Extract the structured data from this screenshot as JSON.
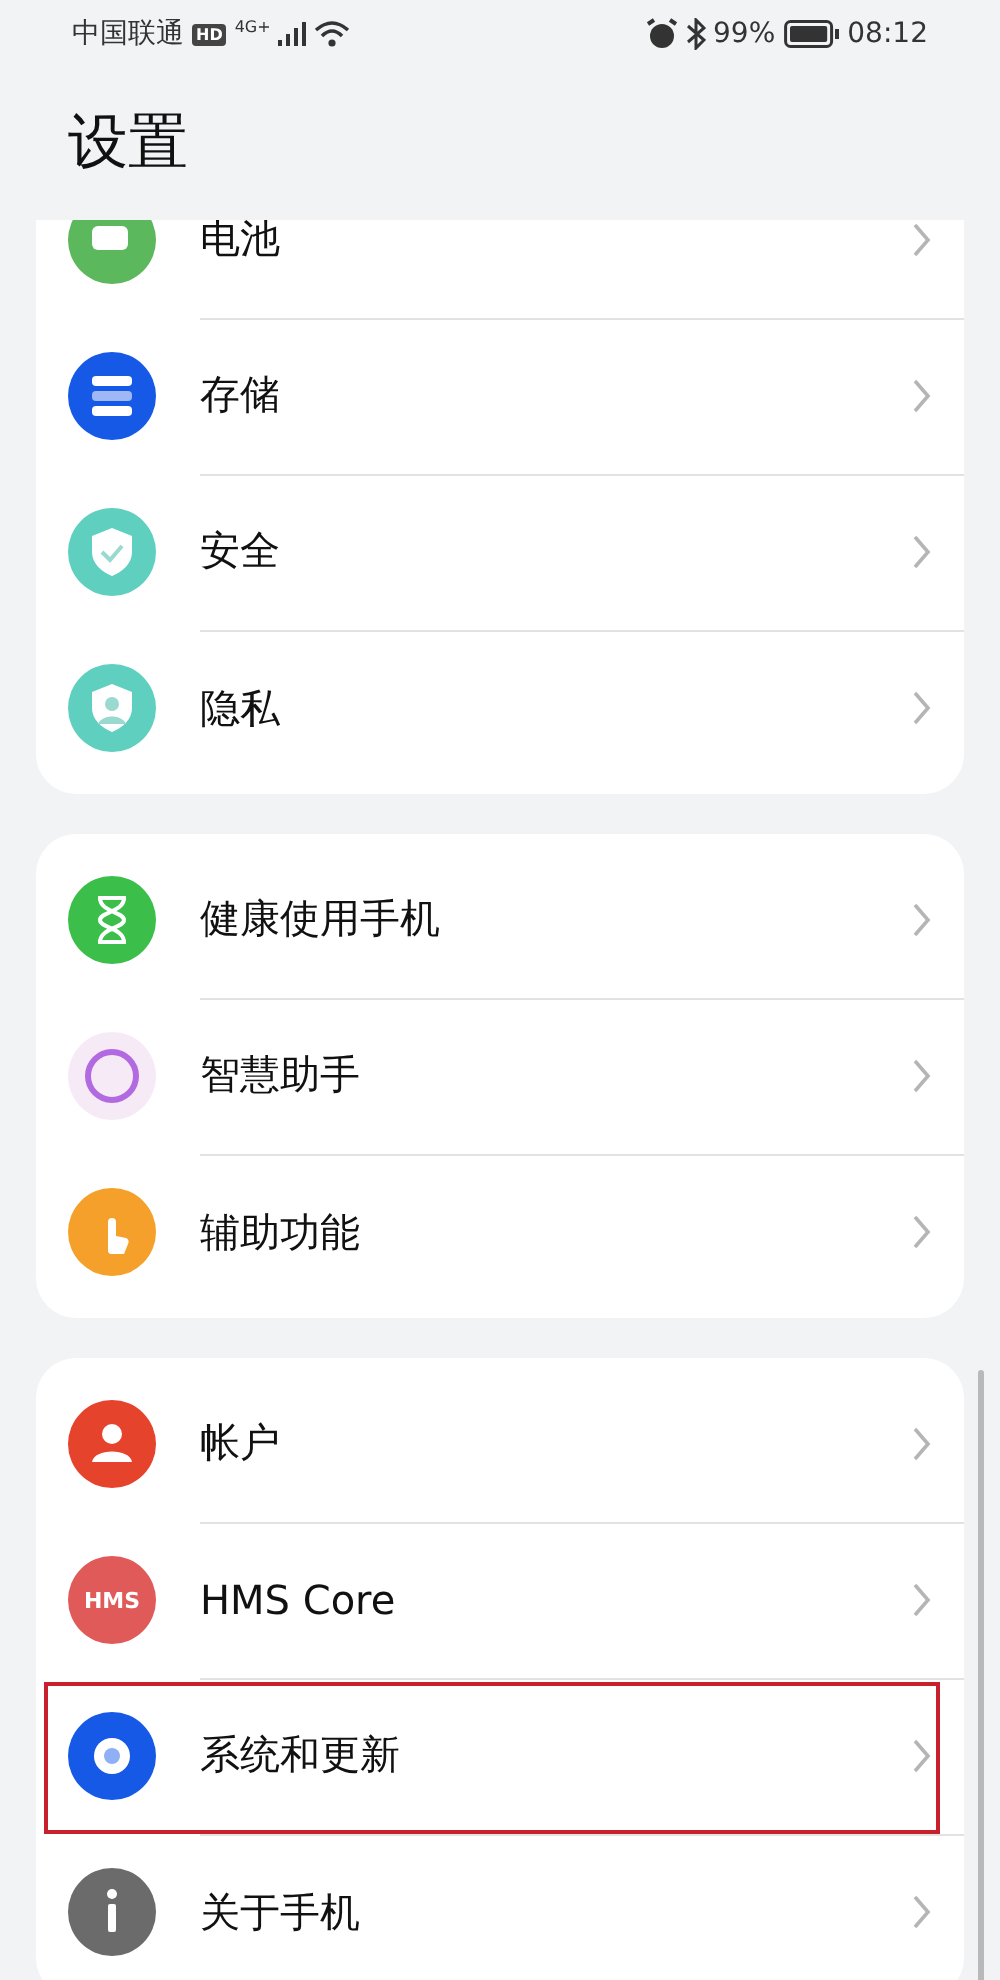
{
  "status_bar": {
    "carrier": "中国联通",
    "hd_badge": "HD",
    "network": "4G",
    "network_plus": "+",
    "battery_percent": "99%",
    "time": "08:12"
  },
  "title": "设置",
  "groups": [
    {
      "items": [
        {
          "label": "电池",
          "color": "#5cb85c",
          "highlighted": false
        },
        {
          "label": "存储",
          "color": "#1659e6",
          "highlighted": false
        },
        {
          "label": "安全",
          "color": "#5fcfbf",
          "highlighted": false
        },
        {
          "label": "隐私",
          "color": "#5fcfbf",
          "highlighted": false
        }
      ]
    },
    {
      "items": [
        {
          "label": "健康使用手机",
          "color": "#3bbf4a",
          "highlighted": false
        },
        {
          "label": "智慧助手",
          "color": "#f6eaf6",
          "highlighted": false
        },
        {
          "label": "辅助功能",
          "color": "#f5a02a",
          "highlighted": false
        }
      ]
    },
    {
      "items": [
        {
          "label": "帐户",
          "color": "#e5432c",
          "highlighted": false
        },
        {
          "label": "HMS Core",
          "color": "#e05a5a",
          "badge_text": "HMS",
          "highlighted": false
        },
        {
          "label": "系统和更新",
          "color": "#1659e6",
          "highlighted": true
        },
        {
          "label": "关于手机",
          "color": "#6b6b6b",
          "highlighted": false
        }
      ]
    }
  ]
}
